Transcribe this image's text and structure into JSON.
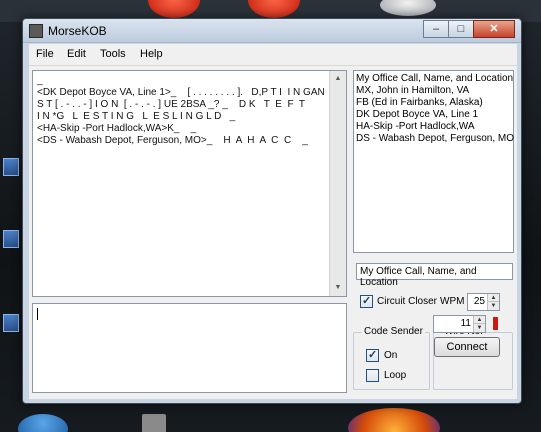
{
  "window": {
    "title": "MorseKOB",
    "minimize": "–",
    "maximize": "□",
    "close": "✕"
  },
  "menu": [
    "File",
    "Edit",
    "Tools",
    "Help"
  ],
  "log_lines": [
    "_",
    "<DK Depot Boyce VA, Line 1>_    [ . . . . . . . . ].   D,P T I  I N GAN",
    "S T [ . - . . - ] I O N  [ . - . - . ] UE 2BSA _? _    D K   T  E  F  T",
    "I N *G   L  E S T I N G   L  E S L I N G L D   _",
    "<HA-Skip -Port Hadlock,WA>K_    _",
    "<DS - Wabash Depot, Ferguson, MO>_    H  A  H  A  C  C    _"
  ],
  "stations": [
    "My Office Call, Name, and Location",
    "MX, John in Hamilton, VA",
    "FB (Ed in Fairbanks, Alaska)",
    "DK Depot Boyce VA, Line 1",
    "HA-Skip -Port Hadlock,WA",
    "DS - Wabash Depot, Ferguson, MO"
  ],
  "office_field": "My Office Call, Name, and Location",
  "circuit_closer": {
    "label": "Circuit Closer",
    "checked": true
  },
  "wpm": {
    "label": "WPM",
    "value": "25"
  },
  "code_sender": {
    "title": "Code Sender",
    "on_label": "On",
    "on_checked": true,
    "loop_label": "Loop",
    "loop_checked": false
  },
  "wire": {
    "title": "Wire No.",
    "value": "11"
  },
  "connect_label": "Connect",
  "colors": {
    "wire_indicator": "#cc1a10",
    "title_bar": "#c9d5e3"
  }
}
